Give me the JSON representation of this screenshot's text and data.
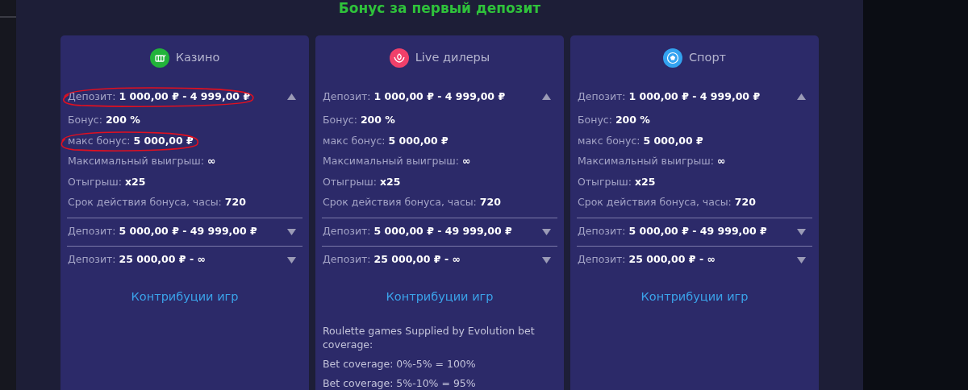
{
  "title": "Бонус за первый депозит",
  "cards": [
    {
      "kind": "casino",
      "color": "#22b33a",
      "category": "Казино",
      "sections": [
        {
          "label": "Депозит:",
          "value": "1 000,00 ₽ - 4 999,00 ₽",
          "expanded": true,
          "circled": true,
          "details": [
            {
              "label": "Бонус:",
              "value": "200 %",
              "circled": false
            },
            {
              "label": "макс бонус:",
              "value": "5 000,00 ₽",
              "circled": true
            },
            {
              "label": "Максимальный выигрыш:",
              "value": "∞",
              "circled": false
            },
            {
              "label": "Отыгрыш:",
              "value": "x25",
              "circled": false
            },
            {
              "label": "Срок действия бонуса, часы:",
              "value": "720",
              "circled": false
            }
          ]
        },
        {
          "label": "Депозит:",
          "value": "5 000,00 ₽ - 49 999,00 ₽",
          "expanded": false,
          "circled": false
        },
        {
          "label": "Депозит:",
          "value": "25 000,00 ₽ - ∞",
          "expanded": false,
          "circled": false
        }
      ],
      "link": "Контрибуции игр"
    },
    {
      "kind": "live",
      "color": "#f0406a",
      "category": "Live дилеры",
      "sections": [
        {
          "label": "Депозит:",
          "value": "1 000,00 ₽ - 4 999,00 ₽",
          "expanded": true,
          "circled": false,
          "details": [
            {
              "label": "Бонус:",
              "value": "200 %",
              "circled": false
            },
            {
              "label": "макс бонус:",
              "value": "5 000,00 ₽",
              "circled": false
            },
            {
              "label": "Максимальный выигрыш:",
              "value": "∞",
              "circled": false
            },
            {
              "label": "Отыгрыш:",
              "value": "x25",
              "circled": false
            },
            {
              "label": "Срок действия бонуса, часы:",
              "value": "720",
              "circled": false
            }
          ]
        },
        {
          "label": "Депозит:",
          "value": "5 000,00 ₽ - 49 999,00 ₽",
          "expanded": false,
          "circled": false
        },
        {
          "label": "Депозит:",
          "value": "25 000,00 ₽ - ∞",
          "expanded": false,
          "circled": false
        }
      ],
      "link": "Контрибуции игр",
      "notes": [
        "Roulette games Supplied by Evolution bet coverage:",
        "Bet coverage: 0%-5% = 100%",
        "Bet coverage: 5%-10% = 95%"
      ]
    },
    {
      "kind": "sport",
      "color": "#33a3f0",
      "category": "Спорт",
      "sections": [
        {
          "label": "Депозит:",
          "value": "1 000,00 ₽ - 4 999,00 ₽",
          "expanded": true,
          "circled": false,
          "details": [
            {
              "label": "Бонус:",
              "value": "200 %",
              "circled": false
            },
            {
              "label": "макс бонус:",
              "value": "5 000,00 ₽",
              "circled": false
            },
            {
              "label": "Максимальный выигрыш:",
              "value": "∞",
              "circled": false
            },
            {
              "label": "Отыгрыш:",
              "value": "x25",
              "circled": false
            },
            {
              "label": "Срок действия бонуса, часы:",
              "value": "720",
              "circled": false
            }
          ]
        },
        {
          "label": "Депозит:",
          "value": "5 000,00 ₽ - 49 999,00 ₽",
          "expanded": false,
          "circled": false
        },
        {
          "label": "Депозит:",
          "value": "25 000,00 ₽ - ∞",
          "expanded": false,
          "circled": false
        }
      ],
      "link": "Контрибуции игр"
    }
  ]
}
